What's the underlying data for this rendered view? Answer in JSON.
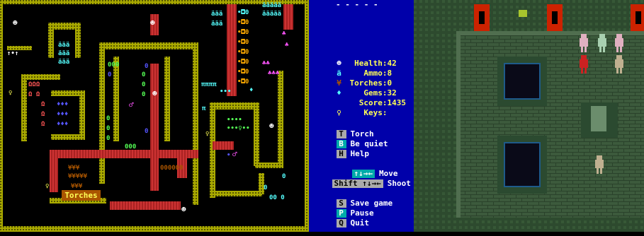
{
  "zzt": {
    "board_label": "Torches",
    "title_bar": "- - - - -",
    "colors": {
      "wall": "#aaaa00",
      "wall_dark": "#555500",
      "red_wall": "#aa0000",
      "pink_wall": "#ff5555",
      "cyan": "#00aaaa",
      "water": "#0000aa",
      "floor": "#000000",
      "white": "#ffffff"
    },
    "icons": [
      "player-icon",
      "key-icon",
      "ammo-icon",
      "gem-icon",
      "torch-icon",
      "door-icon",
      "lion-icon",
      "scroll-icon"
    ]
  },
  "sidebar": {
    "stats": [
      {
        "icon": "health-icon",
        "glyph": "☻",
        "label": "Health:",
        "value": "42"
      },
      {
        "icon": "ammo-icon",
        "glyph": "ä",
        "label": "Ammo:",
        "value": "8"
      },
      {
        "icon": "torch-icon",
        "glyph": "¥",
        "label": "Torches:",
        "value": "0"
      },
      {
        "icon": "gem-icon",
        "glyph": "♦",
        "label": "Gems:",
        "value": "32"
      },
      {
        "icon": "",
        "glyph": "",
        "label": "Score:",
        "value": "1435"
      },
      {
        "icon": "keys-icon",
        "glyph": "♀",
        "label": "Keys:",
        "value": ""
      }
    ],
    "commands": [
      {
        "key": "T",
        "label": "Torch"
      },
      {
        "key": "B",
        "label": "Be quiet"
      },
      {
        "key": "H",
        "label": "Help"
      }
    ],
    "move": {
      "key": "↑↓→←",
      "label": "Move"
    },
    "shoot": {
      "key": "Shift ↑↓→←",
      "label": "Shoot"
    },
    "system": [
      {
        "key": "S",
        "label": "Save game"
      },
      {
        "key": "P",
        "label": "Pause"
      },
      {
        "key": "Q",
        "label": "Quit"
      }
    ]
  },
  "dungeon": {
    "colors": {
      "wall": "#2d4a2e",
      "floor": "#3c5a3c",
      "banner": "#cc2200",
      "pit": "#0a0a18",
      "pit_rim": "#1e5a8a",
      "hero": "#cc2222"
    },
    "icons": [
      "banner-icon",
      "chest-icon",
      "statue-icon",
      "skeleton-icon",
      "hero-icon"
    ]
  }
}
